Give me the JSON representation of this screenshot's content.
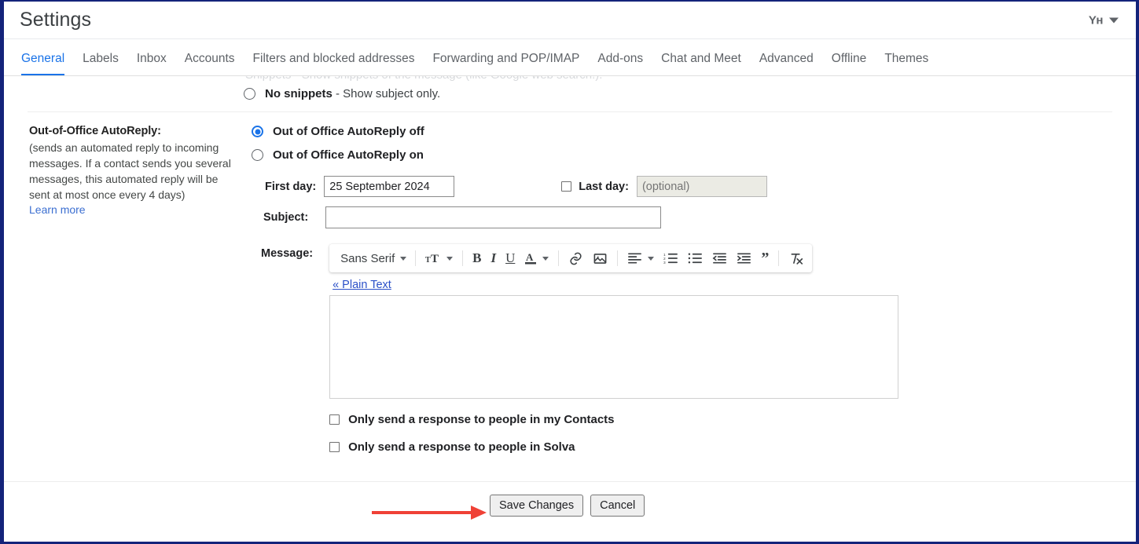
{
  "header": {
    "title": "Settings",
    "account_monogram": "Yн",
    "caret_icon": "chevron-down-icon"
  },
  "tabs": [
    {
      "label": "General",
      "active": true
    },
    {
      "label": "Labels",
      "active": false
    },
    {
      "label": "Inbox",
      "active": false
    },
    {
      "label": "Accounts",
      "active": false
    },
    {
      "label": "Filters and blocked addresses",
      "active": false
    },
    {
      "label": "Forwarding and POP/IMAP",
      "active": false
    },
    {
      "label": "Add-ons",
      "active": false
    },
    {
      "label": "Chat and Meet",
      "active": false
    },
    {
      "label": "Advanced",
      "active": false
    },
    {
      "label": "Offline",
      "active": false
    },
    {
      "label": "Themes",
      "active": false
    }
  ],
  "snippets_row": {
    "option_bold": "No snippets",
    "option_rest": " - Show subject only.",
    "selected": false
  },
  "autoreply": {
    "section_title": "Out-of-Office AutoReply:",
    "description": "(sends an automated reply to incoming messages. If a contact sends you several messages, this automated reply will be sent at most once every 4 days)",
    "learn_more": "Learn more",
    "radio_off": "Out of Office AutoReply off",
    "radio_on": "Out of Office AutoReply on",
    "radio_selected": "off",
    "first_day_label": "First day:",
    "first_day_value": "25 September 2024",
    "last_day_label": "Last day:",
    "last_day_placeholder": "(optional)",
    "last_day_value": "",
    "last_day_checked": false,
    "subject_label": "Subject:",
    "subject_value": "",
    "message_label": "Message:",
    "message_value": "",
    "plain_text_link": "« Plain Text",
    "checkbox_contacts": "Only send a response to people in my Contacts",
    "checkbox_contacts_checked": false,
    "checkbox_domain": "Only send a response to people in Solva",
    "checkbox_domain_checked": false
  },
  "toolbar": {
    "font_family": "Sans Serif",
    "items": [
      {
        "name": "font-family-selector",
        "glyph": "Sans Serif"
      },
      {
        "name": "font-size-icon",
        "glyph": "тT"
      },
      {
        "name": "bold-icon",
        "glyph": "B"
      },
      {
        "name": "italic-icon",
        "glyph": "I"
      },
      {
        "name": "underline-icon",
        "glyph": "U"
      },
      {
        "name": "text-color-icon",
        "glyph": "A"
      },
      {
        "name": "insert-link-icon",
        "glyph": "link"
      },
      {
        "name": "insert-image-icon",
        "glyph": "image"
      },
      {
        "name": "align-icon",
        "glyph": "align"
      },
      {
        "name": "numbered-list-icon",
        "glyph": "numlist"
      },
      {
        "name": "bulleted-list-icon",
        "glyph": "bullist"
      },
      {
        "name": "decrease-indent-icon",
        "glyph": "outdent"
      },
      {
        "name": "increase-indent-icon",
        "glyph": "indent"
      },
      {
        "name": "quote-icon",
        "glyph": "”"
      },
      {
        "name": "remove-formatting-icon",
        "glyph": "clearformat"
      }
    ]
  },
  "footer": {
    "save_label": "Save Changes",
    "cancel_label": "Cancel",
    "annotation_arrow_color": "#ef4136"
  },
  "colors": {
    "accent": "#1a73e8",
    "link": "#3c6fd1",
    "border": "#14237a",
    "text": "#202124",
    "muted": "#5f6368"
  }
}
